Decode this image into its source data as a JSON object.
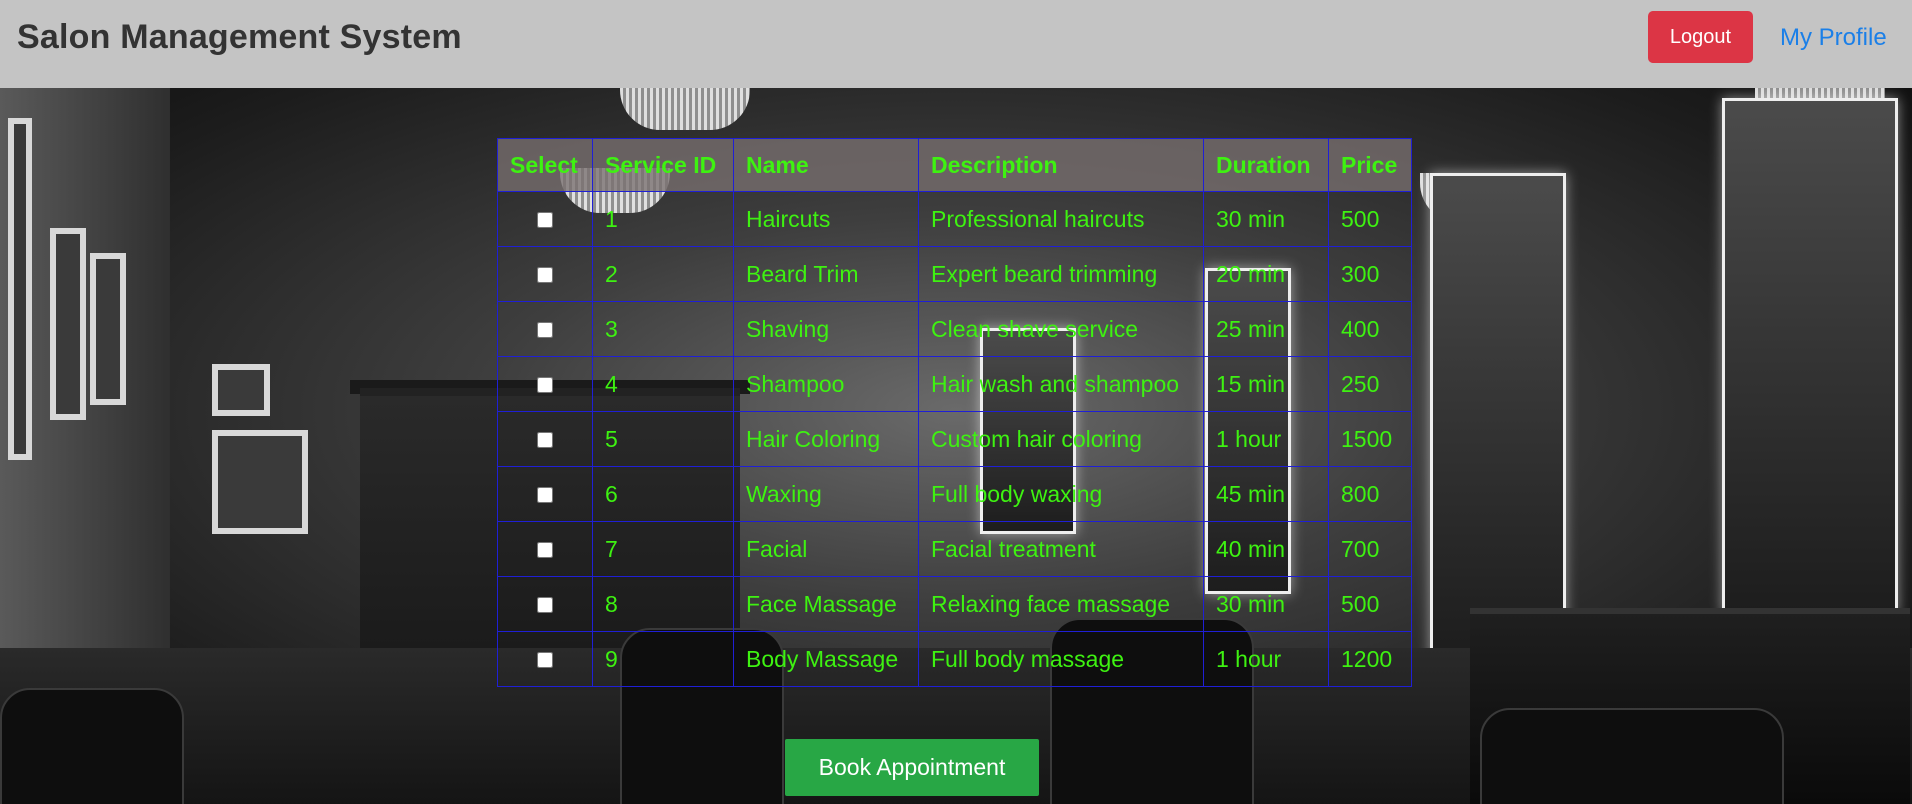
{
  "header": {
    "title": "Salon Management System",
    "logout_label": "Logout",
    "profile_label": "My Profile"
  },
  "table": {
    "headers": [
      "Select",
      "Service ID",
      "Name",
      "Description",
      "Duration",
      "Price"
    ],
    "rows": [
      {
        "id": "1",
        "name": "Haircuts",
        "description": "Professional haircuts",
        "duration": "30 min",
        "price": "500",
        "selected": false
      },
      {
        "id": "2",
        "name": "Beard Trim",
        "description": "Expert beard trimming",
        "duration": "20 min",
        "price": "300",
        "selected": false
      },
      {
        "id": "3",
        "name": "Shaving",
        "description": "Clean shave service",
        "duration": "25 min",
        "price": "400",
        "selected": false
      },
      {
        "id": "4",
        "name": "Shampoo",
        "description": "Hair wash and shampoo",
        "duration": "15 min",
        "price": "250",
        "selected": false
      },
      {
        "id": "5",
        "name": "Hair Coloring",
        "description": "Custom hair coloring",
        "duration": "1 hour",
        "price": "1500",
        "selected": false
      },
      {
        "id": "6",
        "name": "Waxing",
        "description": "Full body waxing",
        "duration": "45 min",
        "price": "800",
        "selected": false
      },
      {
        "id": "7",
        "name": "Facial",
        "description": "Facial treatment",
        "duration": "40 min",
        "price": "700",
        "selected": false
      },
      {
        "id": "8",
        "name": "Face Massage",
        "description": "Relaxing face massage",
        "duration": "30 min",
        "price": "500",
        "selected": false
      },
      {
        "id": "9",
        "name": "Body Massage",
        "description": "Full body massage",
        "duration": "1 hour",
        "price": "1200",
        "selected": false
      }
    ]
  },
  "actions": {
    "book_label": "Book Appointment"
  },
  "colors": {
    "header_bg": "#c4c4c4",
    "logout_bg": "#dc3545",
    "profile_link": "#1a7fe8",
    "table_text": "#3ef211",
    "table_border": "#1f1fd6",
    "book_bg": "#28a745"
  }
}
